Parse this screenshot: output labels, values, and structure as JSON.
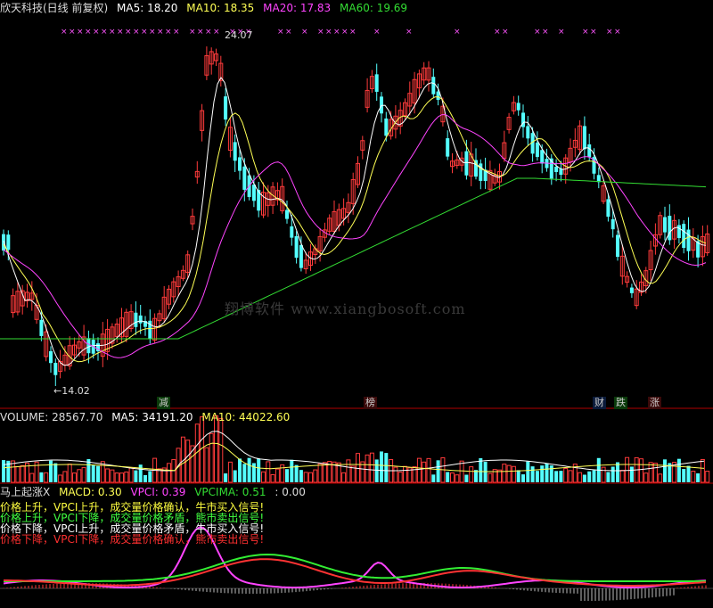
{
  "header": {
    "title": "欣天科技(日线 前复权)",
    "ma5": "MA5: 18.20",
    "ma10": "MA10: 18.35",
    "ma20": "MA20: 17.83",
    "ma60": "MA60: 19.69"
  },
  "price": {
    "high_label": "24.07",
    "low_label": "←14.02",
    "watermark": "翔博软件 www.xiangbosoft.com"
  },
  "event_tags": [
    {
      "text": "减",
      "color": "#30d030"
    },
    {
      "text": "榜",
      "color": "#ff6060"
    },
    {
      "text": "财",
      "color": "#60a0ff"
    },
    {
      "text": "跌",
      "color": "#30d030"
    },
    {
      "text": "涨",
      "color": "#ff4040"
    }
  ],
  "volume": {
    "volume": "VOLUME: 28567.70",
    "ma5": "MA5: 34191.20",
    "ma10": "MA10: 44022.60"
  },
  "indicator": {
    "name": "马上起涨X",
    "macd": "MACD: 0.30",
    "vpci": "VPCI: 0.39",
    "vpcima": "VPCIMA: 0.51",
    "extra": ": 0.00",
    "messages": [
      {
        "text": "价格上升，VPCI上升，成交量价格确认，牛市买入信号!",
        "color": "#ffff40"
      },
      {
        "text": "价格上升，VPCI下降，成交量价格矛盾，熊市卖出信号!",
        "color": "#40ff40"
      },
      {
        "text": "价格下降，VPCI上升，成交量价格矛盾，牛市买入信号!",
        "color": "#ffffff"
      },
      {
        "text": "价格下降，VPCI下降，成交量价格确认，熊市卖出信号!",
        "color": "#ff3030"
      }
    ]
  },
  "colors": {
    "up": "#ff3b3b",
    "down": "#54ffff",
    "ma5": "#ffffff",
    "ma10": "#ffff55",
    "ma20": "#ff44ff",
    "ma60": "#33dd33",
    "axis": "#b00000"
  }
}
